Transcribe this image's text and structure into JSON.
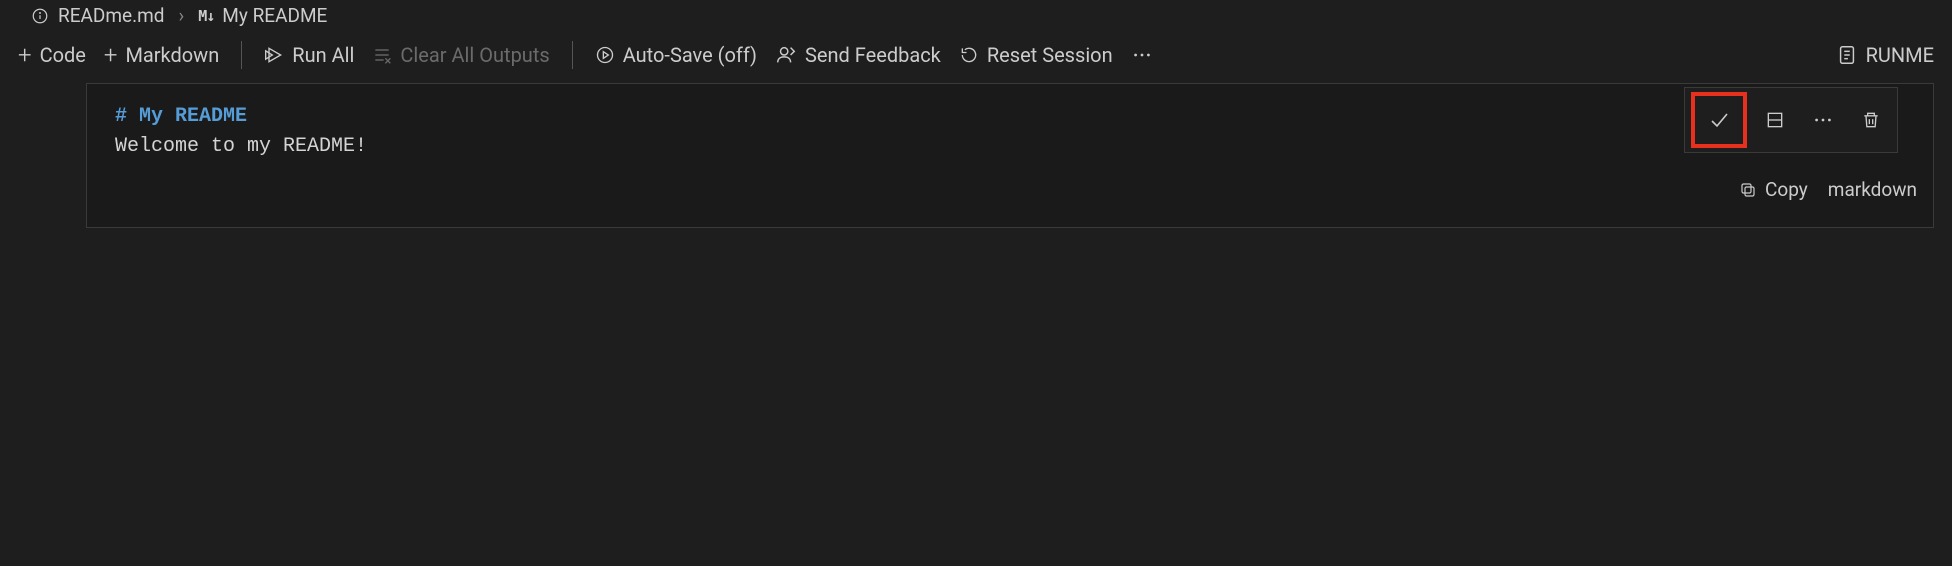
{
  "breadcrumb": {
    "file": "READme.md",
    "section": "My README"
  },
  "toolbar": {
    "code_label": "Code",
    "markdown_label": "Markdown",
    "run_all_label": "Run All",
    "clear_outputs_label": "Clear All Outputs",
    "autosave_label": "Auto-Save (off)",
    "feedback_label": "Send Feedback",
    "reset_label": "Reset Session",
    "runme_label": "RUNME"
  },
  "cell": {
    "heading": "# My README",
    "body": "Welcome to my README!",
    "copy_label": "Copy",
    "language_label": "markdown"
  }
}
